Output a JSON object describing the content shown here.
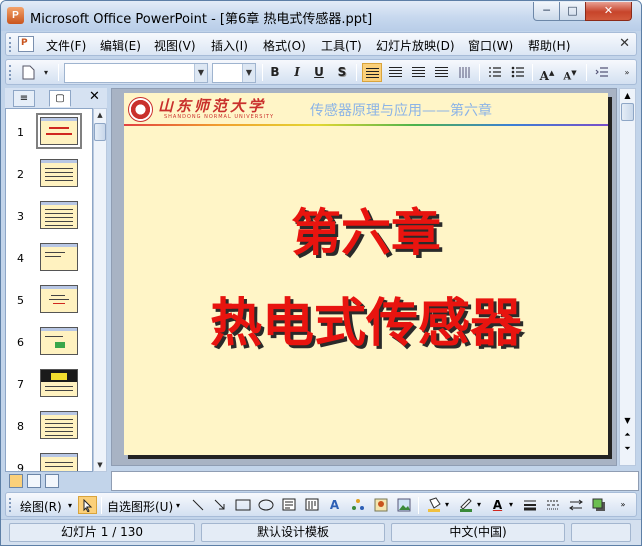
{
  "window": {
    "icon_letter": "P",
    "title": "Microsoft Office PowerPoint - [第6章  热电式传感器.ppt]",
    "buttons": {
      "minimize": "─",
      "maximize": "□",
      "close": "✕"
    }
  },
  "menubar": {
    "items": [
      "文件(F)",
      "编辑(E)",
      "视图(V)",
      "插入(I)",
      "格式(O)",
      "工具(T)",
      "幻灯片放映(D)",
      "窗口(W)",
      "帮助(H)"
    ],
    "close_glyph": "✕"
  },
  "toolbar": {
    "font_name": "",
    "font_size": "",
    "bold": "B",
    "italic": "I",
    "underline": "U",
    "shadow": "S",
    "increase_font": "A",
    "decrease_font": "A"
  },
  "slides_pane": {
    "close_glyph": "✕",
    "thumbnails": [
      {
        "number": "1",
        "selected": true
      },
      {
        "number": "2"
      },
      {
        "number": "3"
      },
      {
        "number": "4"
      },
      {
        "number": "5"
      },
      {
        "number": "6"
      },
      {
        "number": "7"
      },
      {
        "number": "8"
      },
      {
        "number": "9"
      }
    ]
  },
  "slide": {
    "university_name": "山东师范大学",
    "university_name_en": "SHANDONG NORMAL UNIVERSITY",
    "course_title": "传感器原理与应用——第六章",
    "chapter_title": "第六章",
    "chapter_name": "热电式传感器",
    "colors": {
      "background": "#fff5c7",
      "title": "#e8140f",
      "header_text": "#8cb4e6"
    }
  },
  "drawbar": {
    "draw_label": "绘图(R)",
    "autoshapes_label": "自选图形(U)"
  },
  "statusbar": {
    "slide_position": "幻灯片 1 / 130",
    "design_template": "默认设计模板",
    "language": "中文(中国)"
  }
}
